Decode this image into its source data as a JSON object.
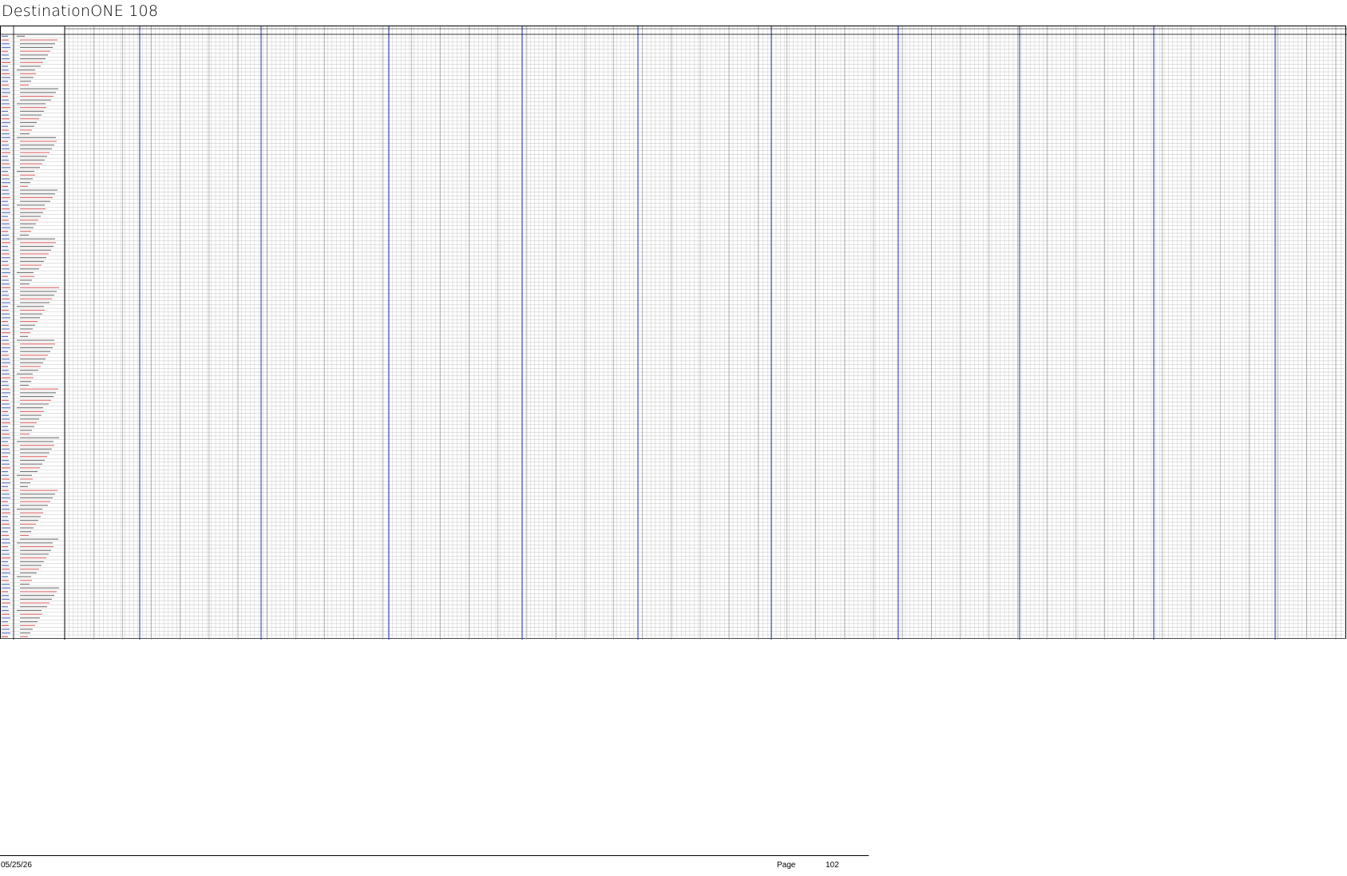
{
  "document": {
    "title": "DestinationONE 108"
  },
  "grid": {
    "column_header_left": "",
    "column_header_desc": "",
    "accent_colors": {
      "grid_line": "#b4b4b4",
      "separator": "#2233aa",
      "text_red": "#cc2222",
      "text_blue": "#2244aa",
      "border": "#000000"
    }
  },
  "footer": {
    "date": "05/25/26",
    "page_label": "Page",
    "page_number": "102"
  }
}
